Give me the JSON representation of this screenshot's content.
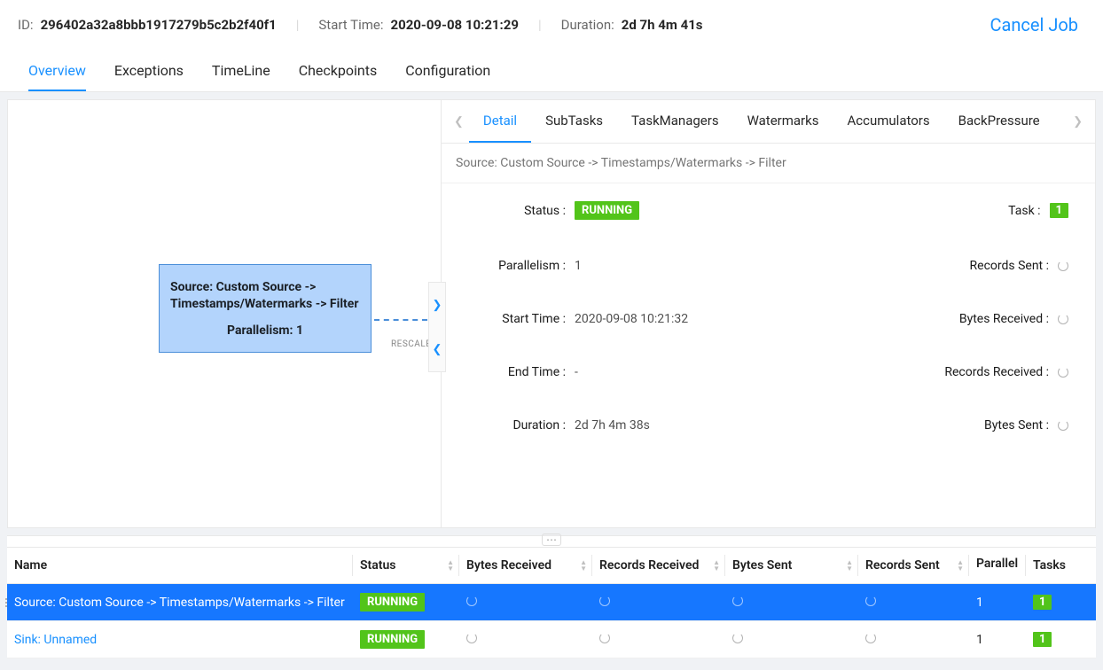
{
  "header": {
    "id_label": "ID:",
    "id_value": "296402a32a8bbb1917279b5c2b2f40f1",
    "start_label": "Start Time:",
    "start_value": "2020-09-08 10:21:29",
    "duration_label": "Duration:",
    "duration_value": "2d 7h 4m 41s",
    "cancel": "Cancel Job"
  },
  "tabs": [
    "Overview",
    "Exceptions",
    "TimeLine",
    "Checkpoints",
    "Configuration"
  ],
  "graph": {
    "node_title": "Source: Custom Source -> Timestamps/Watermarks -> Filter",
    "node_par": "Parallelism: 1",
    "rescale": "RESCALE"
  },
  "detail_tabs": [
    "Detail",
    "SubTasks",
    "TaskManagers",
    "Watermarks",
    "Accumulators",
    "BackPressure"
  ],
  "detail_subtitle": "Source: Custom Source -> Timestamps/Watermarks -> Filter",
  "detail": {
    "status_l": "Status :",
    "status_v": "RUNNING",
    "task_l": "Task :",
    "task_v": "1",
    "par_l": "Parallelism :",
    "par_v": "1",
    "recsent_l": "Records Sent :",
    "start_l": "Start Time :",
    "start_v": "2020-09-08 10:21:32",
    "bytesrecv_l": "Bytes Received :",
    "end_l": "End Time :",
    "end_v": "-",
    "recrecv_l": "Records Received :",
    "dur_l": "Duration :",
    "dur_v": "2d 7h 4m 38s",
    "bytessent_l": "Bytes Sent :"
  },
  "table": {
    "headers": [
      "Name",
      "Status",
      "Bytes Received",
      "Records Received",
      "Bytes Sent",
      "Records Sent",
      "Parallelism",
      "Tasks"
    ],
    "rows": [
      {
        "name": "Source: Custom Source -> Timestamps/Watermarks -> Filter",
        "status": "RUNNING",
        "parallelism": "1",
        "tasks": "1",
        "selected": true
      },
      {
        "name": "Sink: Unnamed",
        "status": "RUNNING",
        "parallelism": "1",
        "tasks": "1",
        "selected": false
      }
    ]
  }
}
